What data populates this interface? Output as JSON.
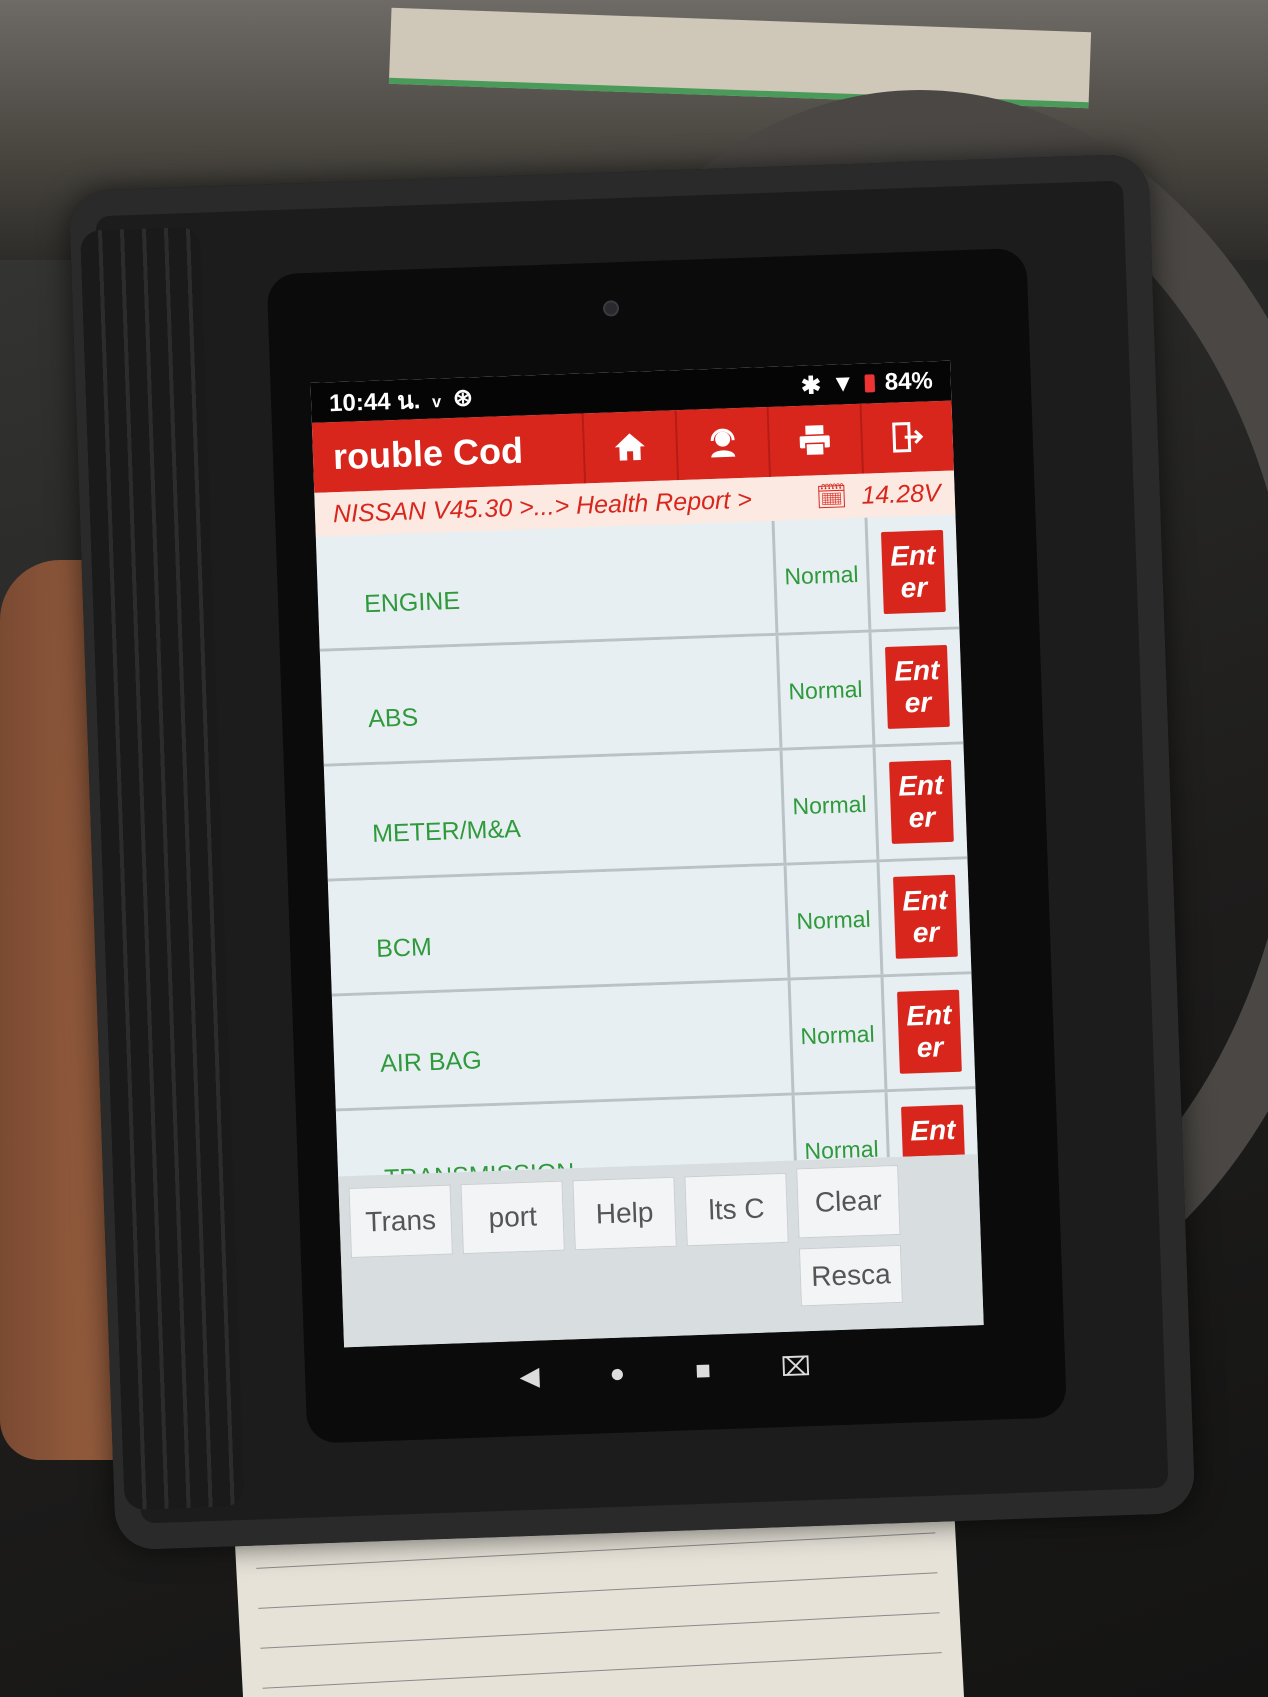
{
  "status_bar": {
    "time": "10:44 น.",
    "battery": "84%"
  },
  "title_bar": {
    "title": "rouble Cod",
    "icons": [
      "home-icon",
      "support-icon",
      "print-icon",
      "exit-icon"
    ]
  },
  "breadcrumb": {
    "path": "NISSAN V45.30 >...> Health Report >",
    "voltage": "14.28V"
  },
  "systems": [
    {
      "name": "ENGINE",
      "status": "Normal",
      "action": "Ent er"
    },
    {
      "name": "ABS",
      "status": "Normal",
      "action": "Ent er"
    },
    {
      "name": "METER/M&A",
      "status": "Normal",
      "action": "Ent er"
    },
    {
      "name": "BCM",
      "status": "Normal",
      "action": "Ent er"
    },
    {
      "name": "AIR BAG",
      "status": "Normal",
      "action": "Ent er"
    },
    {
      "name": "TRANSMISSION",
      "status": "Normal",
      "action": "Ent er"
    }
  ],
  "bottom_buttons": {
    "trans": "Trans",
    "port": "port",
    "help": "Help",
    "its": "lts  C",
    "clear": "Clear",
    "rescan": "Resca"
  },
  "colors": {
    "accent": "#d8261d",
    "status_text": "#2f9a3c"
  }
}
